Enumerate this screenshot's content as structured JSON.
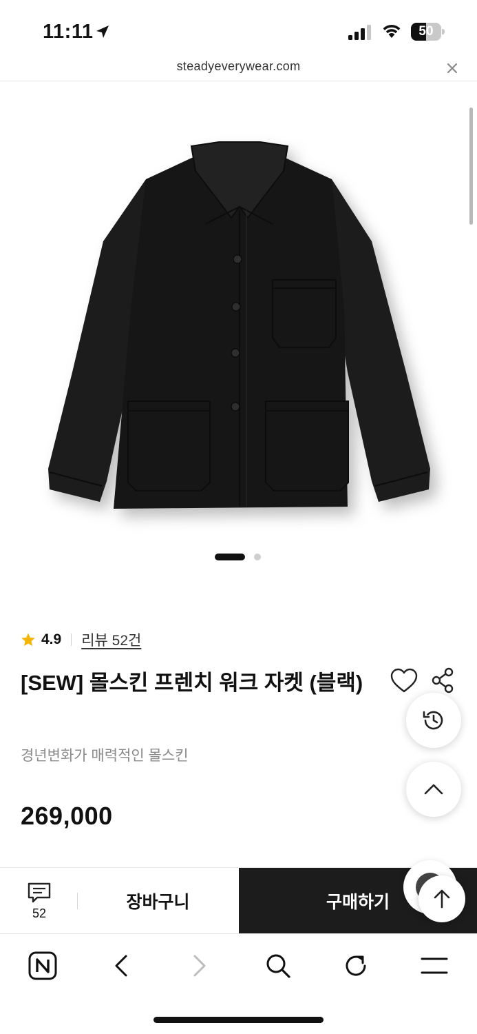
{
  "status_bar": {
    "time": "11:11",
    "battery": "50",
    "battery_level": 0.5
  },
  "browser": {
    "url": "steadyeverywear.com"
  },
  "carousel": {
    "total": 2,
    "active_index": 0
  },
  "product": {
    "rating": "4.9",
    "review_link": "리뷰 52건",
    "title": "[SEW] 몰스킨 프렌치 워크 자켓 (블랙)",
    "subtitle": "경년변화가 매력적인 몰스킨",
    "price": "269,000"
  },
  "action_bar": {
    "qna_count": "52",
    "cart_label": "장바구니",
    "buy_label": "구매하기"
  },
  "colors": {
    "star": "#f5b400",
    "buy_button": "#1c1c1c"
  },
  "icons": [
    "location-arrow-icon",
    "signal-icon",
    "wifi-icon",
    "battery-icon",
    "close-icon",
    "star-icon",
    "heart-icon",
    "share-icon",
    "history-icon",
    "chevron-up-icon",
    "chat-icon",
    "arrow-up-icon",
    "naver-home-icon",
    "back-icon",
    "forward-icon",
    "search-icon",
    "refresh-icon",
    "menu-icon"
  ]
}
